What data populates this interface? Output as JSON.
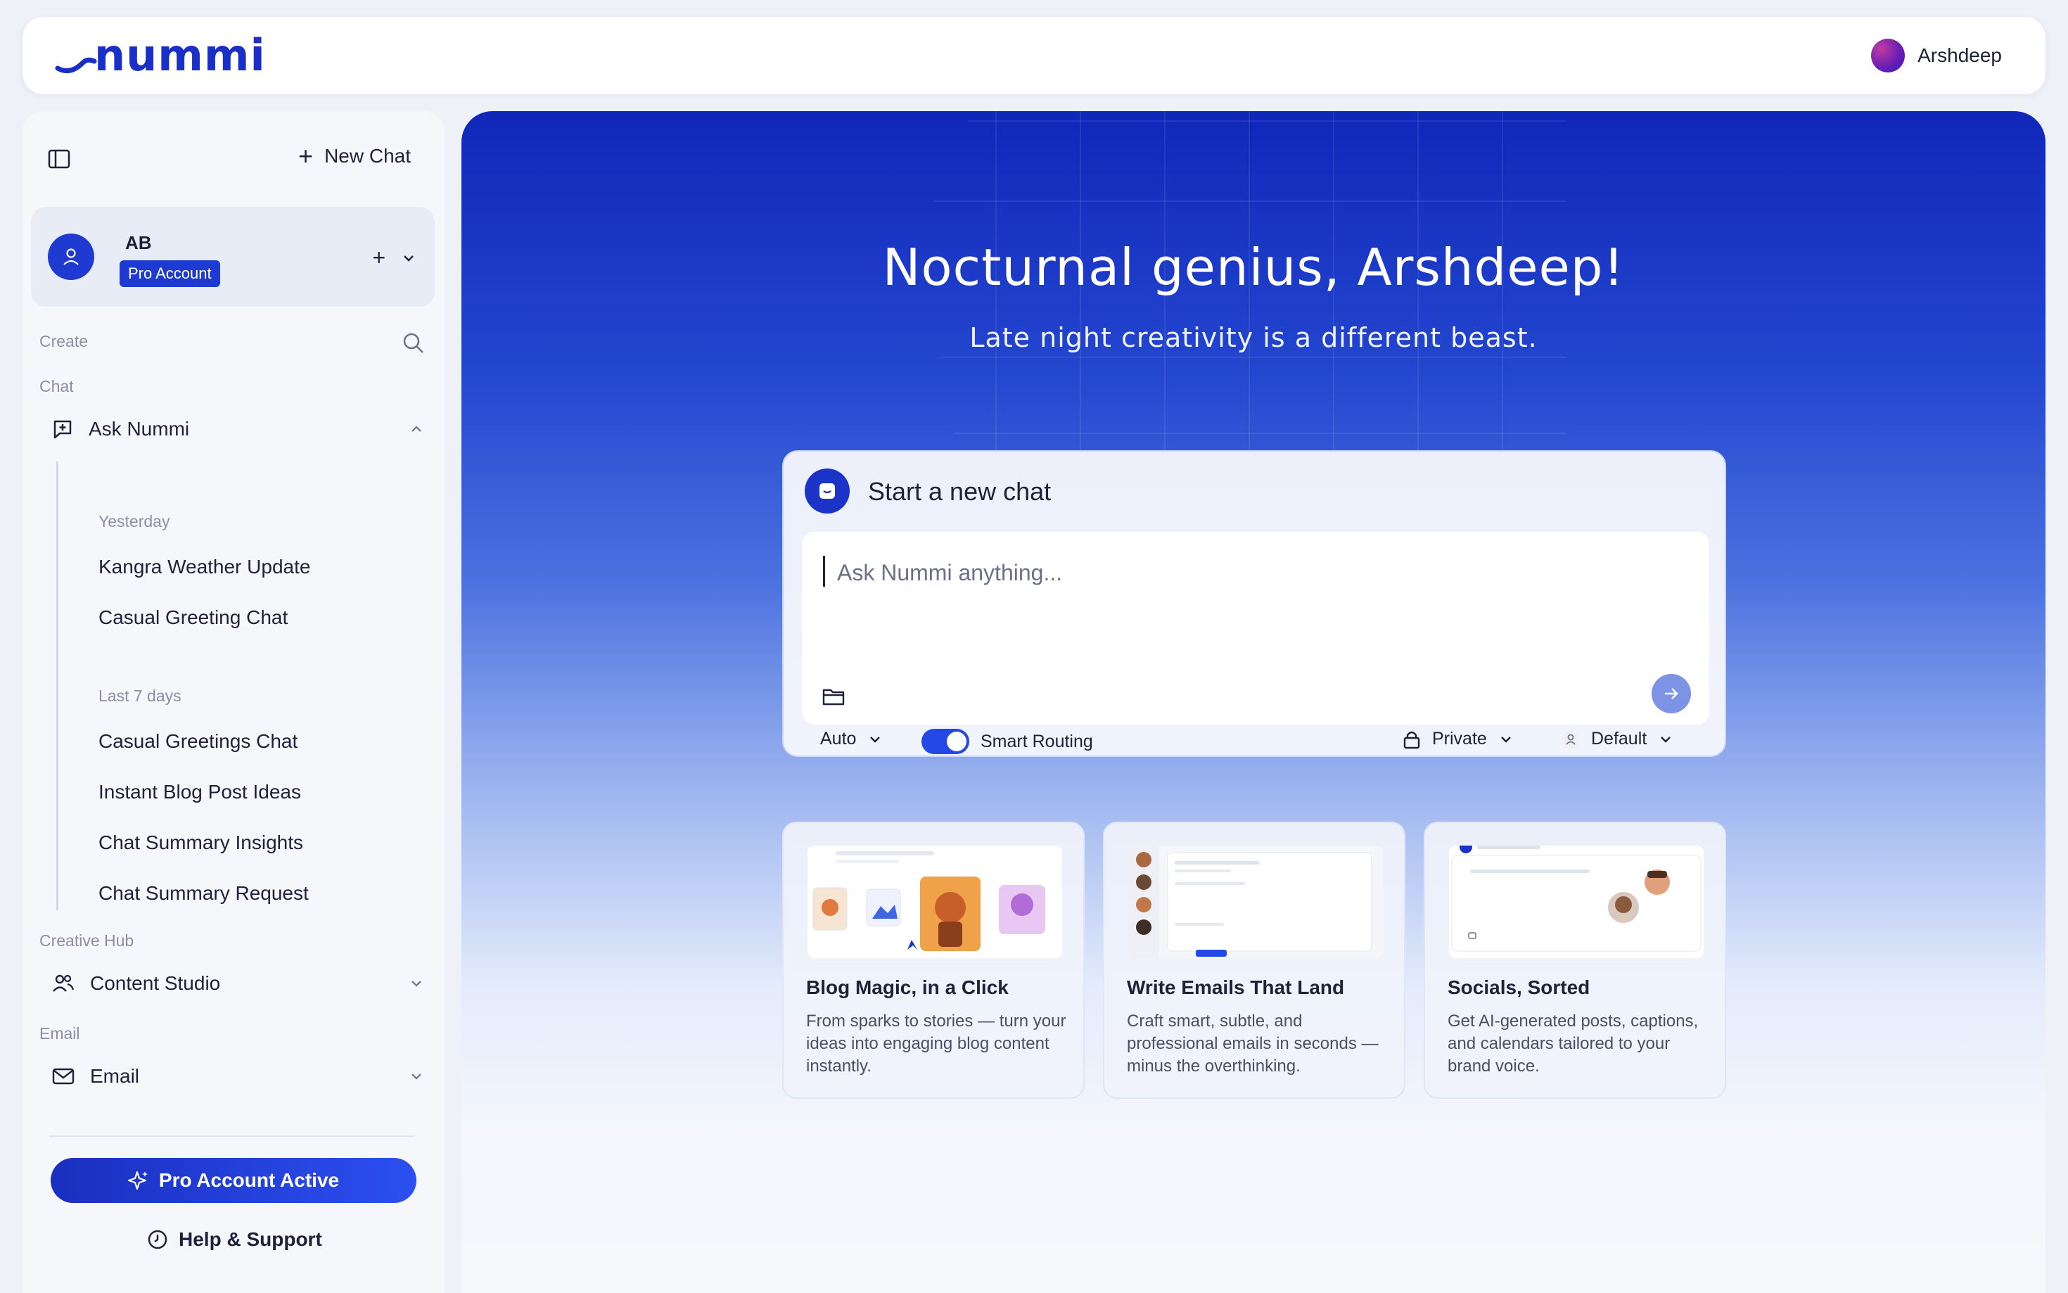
{
  "brand": {
    "logo_text": "nummi",
    "accent": "#1a2ec8"
  },
  "topbar": {
    "user_name": "Arshdeep"
  },
  "sidebar": {
    "new_chat_label": "New Chat",
    "account": {
      "name": "AB",
      "badge": "Pro Account"
    },
    "sections": {
      "create": "Create",
      "chat": "Chat",
      "creative_hub": "Creative Hub",
      "email": "Email"
    },
    "ask_nummi": "Ask Nummi",
    "history": {
      "yesterday_label": "Yesterday",
      "yesterday": [
        "Kangra Weather Update",
        "Casual Greeting Chat"
      ],
      "last7_label": "Last 7 days",
      "last7": [
        "Casual Greetings Chat",
        "Instant Blog Post Ideas",
        "Chat Summary Insights",
        "Chat Summary Request"
      ]
    },
    "content_studio": "Content Studio",
    "email_item": "Email",
    "pro_button": "Pro Account Active",
    "help": "Help & Support"
  },
  "main": {
    "greeting": "Nocturnal genius, Arshdeep!",
    "subgreeting": "Late night creativity is a different beast.",
    "chat": {
      "title": "Start a new chat",
      "placeholder": "Ask Nummi anything...",
      "model": "Auto",
      "smart_routing": "Smart Routing",
      "smart_routing_on": true,
      "privacy": "Private",
      "persona": "Default"
    },
    "features": [
      {
        "title": "Blog Magic, in a Click",
        "desc": "From sparks to stories — turn your ideas into engaging blog content instantly."
      },
      {
        "title": "Write Emails That Land",
        "desc": "Craft smart, subtle, and professional emails in seconds — minus the overthinking."
      },
      {
        "title": "Socials, Sorted",
        "desc": "Get AI-generated posts, captions, and calendars tailored to your brand voice."
      }
    ]
  }
}
